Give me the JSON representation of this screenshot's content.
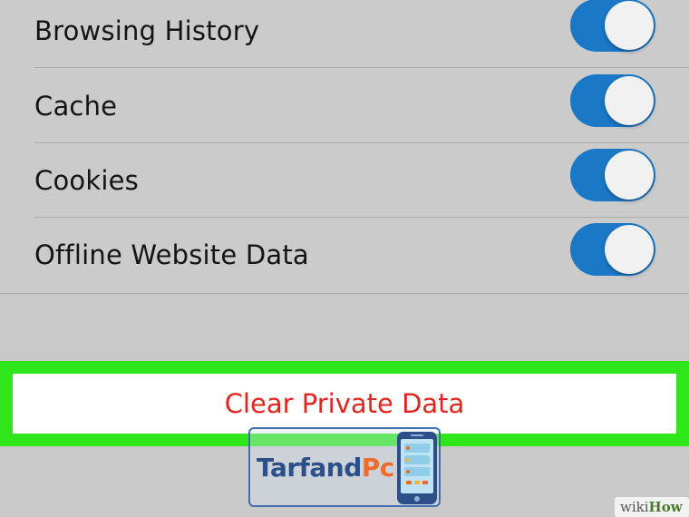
{
  "settings": {
    "items": [
      {
        "label": "Browsing History",
        "enabled": true
      },
      {
        "label": "Cache",
        "enabled": true
      },
      {
        "label": "Cookies",
        "enabled": true
      },
      {
        "label": "Offline Website Data",
        "enabled": true
      }
    ]
  },
  "clear_button": {
    "label": "Clear Private Data",
    "color": "#e2261f"
  },
  "highlight_color": "#2ee61a",
  "toggle_on_color": "#1a78c7",
  "watermark": {
    "text_main": "Tarfand",
    "text_accent": "Pc"
  },
  "badge": {
    "wiki": "wiki",
    "how": "How"
  }
}
